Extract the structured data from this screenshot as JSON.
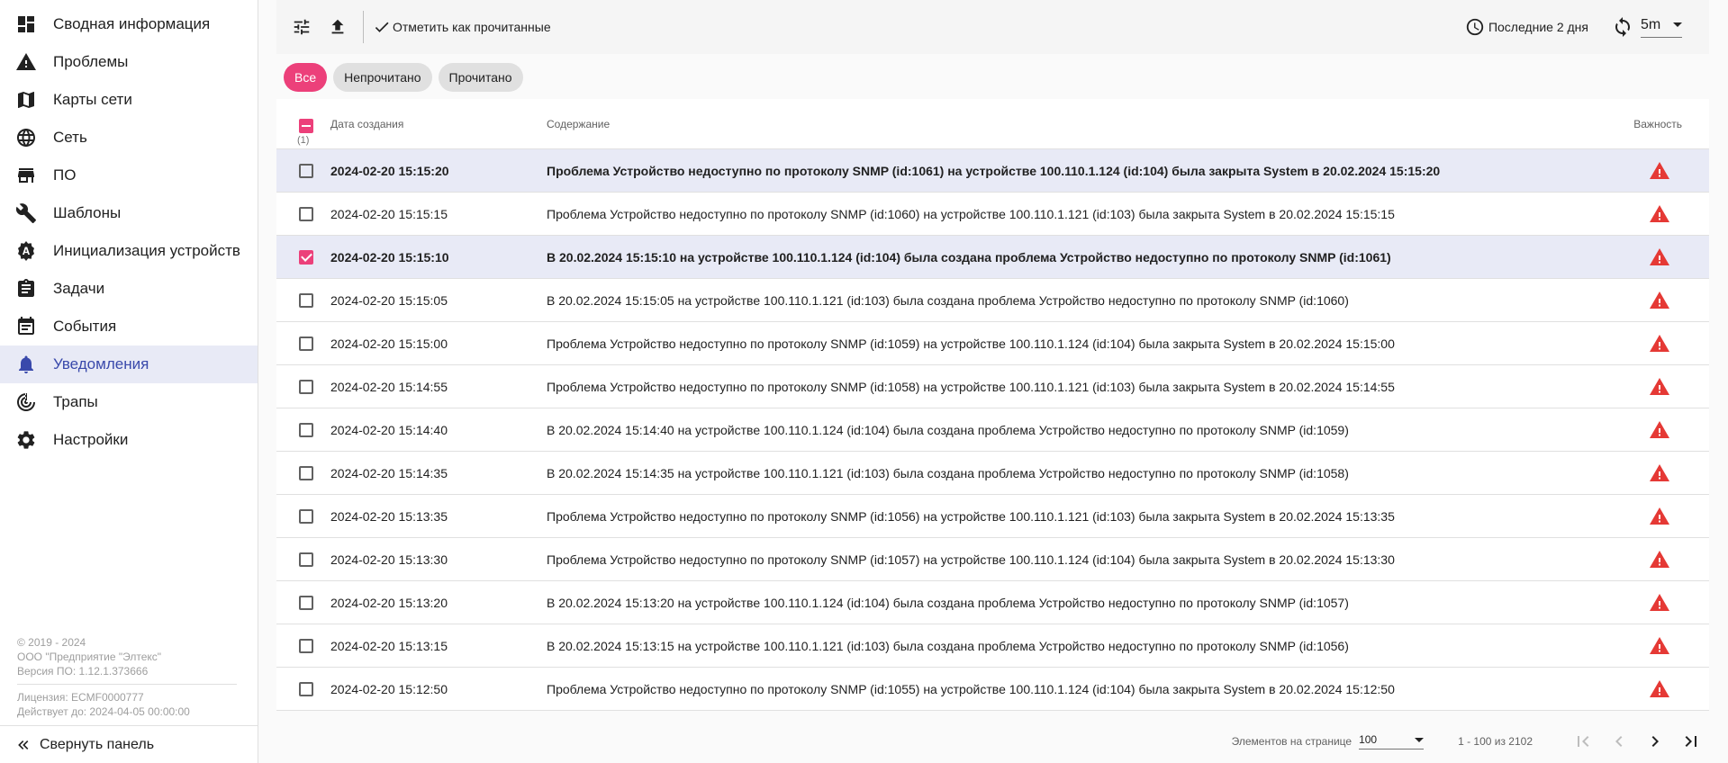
{
  "sidebar": {
    "items": [
      {
        "label": "Сводная информация",
        "icon": "dashboard-icon"
      },
      {
        "label": "Проблемы",
        "icon": "warning-icon"
      },
      {
        "label": "Карты сети",
        "icon": "map-icon"
      },
      {
        "label": "Сеть",
        "icon": "globe-icon"
      },
      {
        "label": "ПО",
        "icon": "store-icon"
      },
      {
        "label": "Шаблоны",
        "icon": "wrench-icon"
      },
      {
        "label": "Инициализация устройств",
        "icon": "auto-icon"
      },
      {
        "label": "Задачи",
        "icon": "clipboard-icon"
      },
      {
        "label": "События",
        "icon": "event-icon"
      },
      {
        "label": "Уведомления",
        "icon": "bell-icon"
      },
      {
        "label": "Трапы",
        "icon": "trap-icon"
      },
      {
        "label": "Настройки",
        "icon": "gear-icon"
      }
    ],
    "active_index": 9,
    "footer": {
      "copyright": "© 2019 - 2024",
      "company": "ООО \"Предприятие \"Элтекс\"",
      "version": "Версия ПО: 1.12.1.373666",
      "license": "Лицензия: ECMF0000777",
      "valid_until": "Действует до: 2024-04-05 00:00:00"
    },
    "collapse_label": "Свернуть панель"
  },
  "toolbar": {
    "mark_read_label": "Отметить как прочитанные",
    "period_label": "Последние 2 дня",
    "refresh_interval": "5m"
  },
  "filters": {
    "chips": [
      "Все",
      "Непрочитано",
      "Прочитано"
    ],
    "active": "Все"
  },
  "table": {
    "headers": {
      "date": "Дата создания",
      "content": "Содержание",
      "severity": "Важность"
    },
    "selected_count": "(1)",
    "rows": [
      {
        "date": "2024-02-20 15:15:20",
        "content": "Проблема Устройство недоступно по протоколу SNMP (id:1061) на устройстве 100.110.1.124 (id:104) была закрыта System в 20.02.2024 15:15:20",
        "checked": false,
        "state": "unread"
      },
      {
        "date": "2024-02-20 15:15:15",
        "content": "Проблема Устройство недоступно по протоколу SNMP (id:1060) на устройстве 100.110.1.121 (id:103) была закрыта System в 20.02.2024 15:15:15",
        "checked": false,
        "state": "read"
      },
      {
        "date": "2024-02-20 15:15:10",
        "content": "В 20.02.2024 15:15:10 на устройстве 100.110.1.124 (id:104) была создана проблема Устройство недоступно по протоколу SNMP (id:1061)",
        "checked": true,
        "state": "unread"
      },
      {
        "date": "2024-02-20 15:15:05",
        "content": "В 20.02.2024 15:15:05 на устройстве 100.110.1.121 (id:103) была создана проблема Устройство недоступно по протоколу SNMP (id:1060)",
        "checked": false,
        "state": "read"
      },
      {
        "date": "2024-02-20 15:15:00",
        "content": "Проблема Устройство недоступно по протоколу SNMP (id:1059) на устройстве 100.110.1.124 (id:104) была закрыта System в 20.02.2024 15:15:00",
        "checked": false,
        "state": "read"
      },
      {
        "date": "2024-02-20 15:14:55",
        "content": "Проблема Устройство недоступно по протоколу SNMP (id:1058) на устройстве 100.110.1.121 (id:103) была закрыта System в 20.02.2024 15:14:55",
        "checked": false,
        "state": "read"
      },
      {
        "date": "2024-02-20 15:14:40",
        "content": "В 20.02.2024 15:14:40 на устройстве 100.110.1.124 (id:104) была создана проблема Устройство недоступно по протоколу SNMP (id:1059)",
        "checked": false,
        "state": "read"
      },
      {
        "date": "2024-02-20 15:14:35",
        "content": "В 20.02.2024 15:14:35 на устройстве 100.110.1.121 (id:103) была создана проблема Устройство недоступно по протоколу SNMP (id:1058)",
        "checked": false,
        "state": "read"
      },
      {
        "date": "2024-02-20 15:13:35",
        "content": "Проблема Устройство недоступно по протоколу SNMP (id:1056) на устройстве 100.110.1.121 (id:103) была закрыта System в 20.02.2024 15:13:35",
        "checked": false,
        "state": "read"
      },
      {
        "date": "2024-02-20 15:13:30",
        "content": "Проблема Устройство недоступно по протоколу SNMP (id:1057) на устройстве 100.110.1.124 (id:104) была закрыта System в 20.02.2024 15:13:30",
        "checked": false,
        "state": "read"
      },
      {
        "date": "2024-02-20 15:13:20",
        "content": "В 20.02.2024 15:13:20 на устройстве 100.110.1.124 (id:104) была создана проблема Устройство недоступно по протоколу SNMP (id:1057)",
        "checked": false,
        "state": "read"
      },
      {
        "date": "2024-02-20 15:13:15",
        "content": "В 20.02.2024 15:13:15 на устройстве 100.110.1.121 (id:103) была создана проблема Устройство недоступно по протоколу SNMP (id:1056)",
        "checked": false,
        "state": "read"
      },
      {
        "date": "2024-02-20 15:12:50",
        "content": "Проблема Устройство недоступно по протоколу SNMP (id:1055) на устройстве 100.110.1.124 (id:104) была закрыта System в 20.02.2024 15:12:50",
        "checked": false,
        "state": "read"
      }
    ],
    "severity_icon": "warning-triangle-icon",
    "severity_color": "#e53935"
  },
  "pagination": {
    "per_page_label": "Элементов на странице",
    "per_page": "100",
    "range": "1 - 100 из 2102"
  },
  "colors": {
    "accent": "#ec407a",
    "active_nav": "#3949ab",
    "selected_row": "#e8eaf6"
  }
}
